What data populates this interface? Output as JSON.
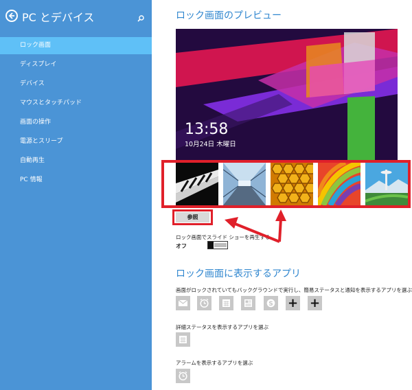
{
  "sidebar": {
    "title": "PC とデバイス",
    "items": [
      {
        "label": "ロック画面"
      },
      {
        "label": "ディスプレイ"
      },
      {
        "label": "デバイス"
      },
      {
        "label": "マウスとタッチパッド"
      },
      {
        "label": "画面の操作"
      },
      {
        "label": "電源とスリープ"
      },
      {
        "label": "自動再生"
      },
      {
        "label": "PC 情報"
      }
    ],
    "active_index": 0
  },
  "preview": {
    "heading": "ロック画面のプレビュー",
    "time": "13:58",
    "date": "10月24日 木曜日"
  },
  "thumbnails": [
    {
      "icon": "piano-keys-image"
    },
    {
      "icon": "tunnel-image"
    },
    {
      "icon": "honeycomb-image"
    },
    {
      "icon": "rainbow-stripes-image"
    },
    {
      "icon": "space-needle-image"
    }
  ],
  "browse_label": "参照",
  "slideshow": {
    "label": "ロック画面でスライド ショーを再生する",
    "state": "オフ"
  },
  "apps": {
    "heading": "ロック画面に表示するアプリ",
    "quick_label": "画面がロックされていてもバックグラウンドで実行し、簡易ステータスと通知を表示するアプリを選ぶ",
    "quick_icons": [
      "mail-icon",
      "alarm-icon",
      "calendar-icon",
      "news-icon",
      "skype-icon",
      "plus-icon",
      "plus-icon"
    ],
    "detailed_label": "詳細ステータスを表示するアプリを選ぶ",
    "detailed_icon": "calendar-icon",
    "alarm_label": "アラームを表示するアプリを選ぶ",
    "alarm_icon": "alarm-icon"
  },
  "colors": {
    "sidebar_bg": "#4b94d6",
    "sidebar_active": "#5fc0f7",
    "heading": "#2f86cf",
    "annotation_red": "#e0202a"
  }
}
